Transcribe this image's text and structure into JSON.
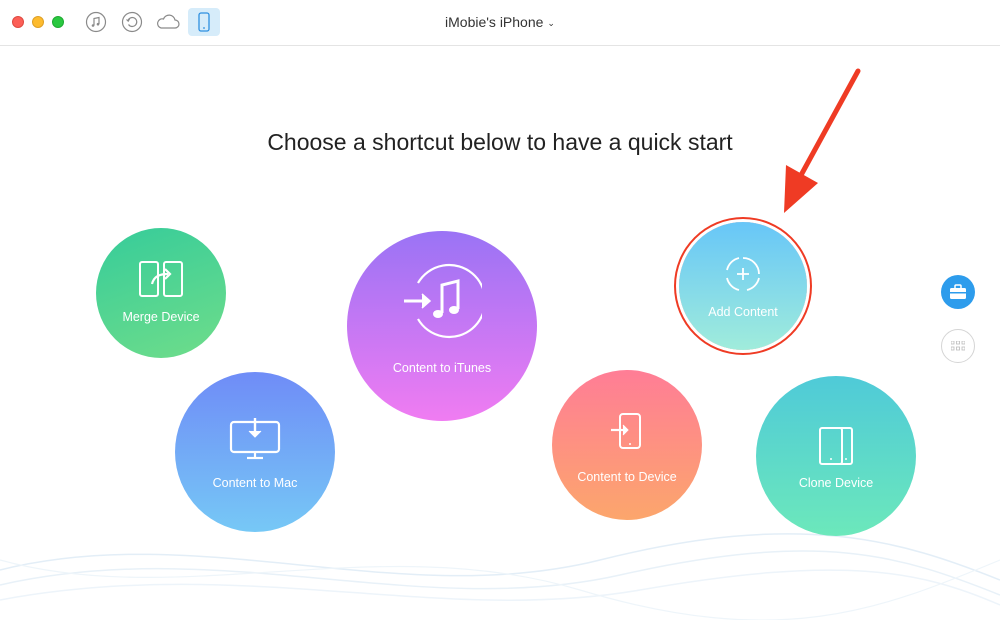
{
  "window": {
    "device_title": "iMobie's iPhone",
    "toolbar_icons": [
      "itunes-icon",
      "history-icon",
      "icloud-icon",
      "iphone-icon"
    ]
  },
  "main": {
    "headline": "Choose a shortcut below to have a quick start",
    "shortcuts": {
      "merge_device": "Merge Device",
      "content_to_mac": "Content to Mac",
      "content_to_itunes": "Content to iTunes",
      "add_content": "Add Content",
      "content_to_device": "Content to Device",
      "clone_device": "Clone Device"
    }
  },
  "sidebar": {
    "icons": [
      "toolkit-icon",
      "grid-icon"
    ]
  },
  "colors": {
    "highlight": "#ef3b24",
    "selected_tab_bg": "#d6ecfa",
    "toolkit_blue": "#2d9cec"
  }
}
